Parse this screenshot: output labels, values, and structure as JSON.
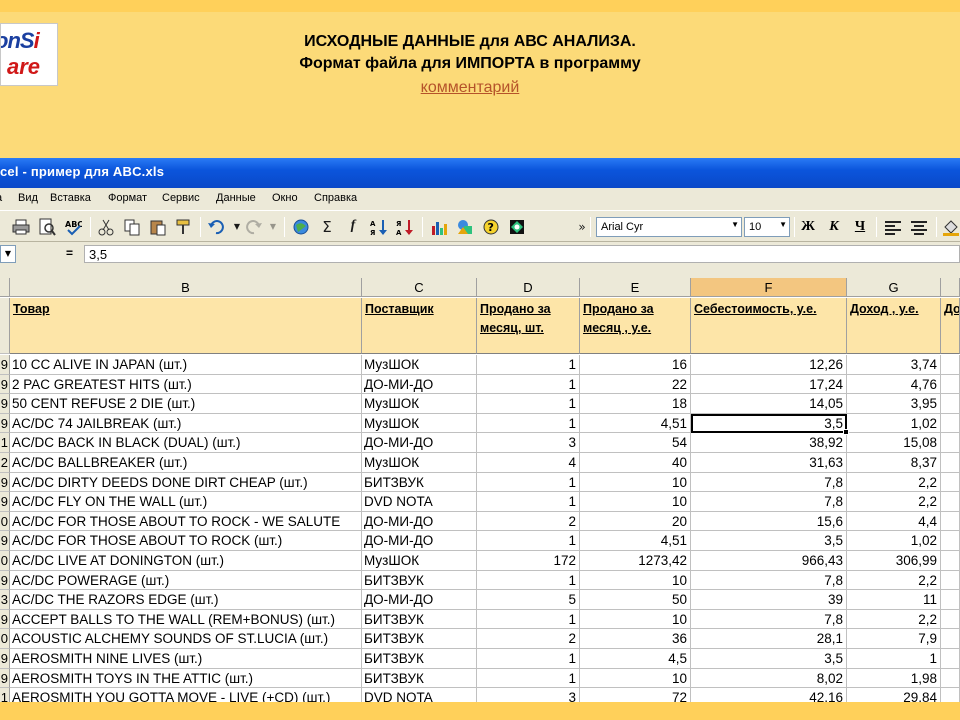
{
  "slide": {
    "logo_line1_a": "onS",
    "logo_line1_b": "i",
    "logo_line2": "are",
    "heading_line1": "ИСХОДНЫЕ ДАННЫЕ для АВС АНАЛИЗА.",
    "heading_line2": "Формат файла для ИМПОРТА в программу",
    "link_label": "комментарий"
  },
  "window": {
    "title": "cel - пример для ABC.xls"
  },
  "menu": [
    "а",
    "Вид",
    "Вставка",
    "Формат",
    "Сервис",
    "Данные",
    "Окно",
    "Справка"
  ],
  "toolbar": {
    "icons": [
      "print-icon",
      "print-preview-icon",
      "spelling-icon",
      "cut-icon",
      "copy-icon",
      "paste-icon",
      "format-painter-icon",
      "undo-icon",
      "redo-icon",
      "hyperlink-icon",
      "autosum-icon",
      "function-icon",
      "sort-ascending-icon",
      "sort-descending-icon",
      "chart-wizard-icon",
      "drawing-icon",
      "help-icon",
      "shapes-icon"
    ],
    "sigma": "Σ",
    "fx": "f",
    "more": "»",
    "font_name": "Arial Cyr",
    "font_size": "10",
    "bold": "Ж",
    "italic": "К",
    "underline": "Ч"
  },
  "formula_bar": {
    "equals": "=",
    "value": "3,5"
  },
  "sheet": {
    "column_letters": [
      "B",
      "C",
      "D",
      "E",
      "F",
      "G"
    ],
    "headers": {
      "product": "Товар",
      "supplier": "Поставщик",
      "sold_qty": "Продано за месяц, шт.",
      "sold_sum": "Продано за месяц , у.е.",
      "cost": "Себестоимость, у.е.",
      "income": "Доход , у.е.",
      "next": "До"
    },
    "rows": [
      {
        "a": "9",
        "product": "10 CC ALIVE IN JAPAN (шт.)",
        "supplier": "МузШОК",
        "qty": "1",
        "sum": "16",
        "cost": "12,26",
        "income": "3,74"
      },
      {
        "a": "9",
        "product": "2 PAC GREATEST HITS (шт.)",
        "supplier": "ДО-МИ-ДО",
        "qty": "1",
        "sum": "22",
        "cost": "17,24",
        "income": "4,76"
      },
      {
        "a": "9",
        "product": "50 CENT REFUSE 2 DIE (шт.)",
        "supplier": "МузШОК",
        "qty": "1",
        "sum": "18",
        "cost": "14,05",
        "income": "3,95"
      },
      {
        "a": "9",
        "product": "AC/DC 74 JAILBREAK (шт.)",
        "supplier": "МузШОК",
        "qty": "1",
        "sum": "4,51",
        "cost": "3,5",
        "income": "1,02"
      },
      {
        "a": "1",
        "product": "AC/DC BACK IN BLACK (DUAL) (шт.)",
        "supplier": "ДО-МИ-ДО",
        "qty": "3",
        "sum": "54",
        "cost": "38,92",
        "income": "15,08"
      },
      {
        "a": "2",
        "product": "AC/DC BALLBREAKER (шт.)",
        "supplier": "МузШОК",
        "qty": "4",
        "sum": "40",
        "cost": "31,63",
        "income": "8,37"
      },
      {
        "a": "9",
        "product": "AC/DC DIRTY DEEDS DONE DIRT CHEAP (шт.)",
        "supplier": "БИТЗВУК",
        "qty": "1",
        "sum": "10",
        "cost": "7,8",
        "income": "2,2"
      },
      {
        "a": "9",
        "product": "AC/DC FLY ON THE WALL (шт.)",
        "supplier": "DVD NOTA",
        "qty": "1",
        "sum": "10",
        "cost": "7,8",
        "income": "2,2"
      },
      {
        "a": "0",
        "product": "AC/DC FOR THOSE ABOUT TO ROCK - WE SALUTE",
        "supplier": "ДО-МИ-ДО",
        "qty": "2",
        "sum": "20",
        "cost": "15,6",
        "income": "4,4"
      },
      {
        "a": "9",
        "product": "AC/DC FOR THOSE ABOUT TO ROCK (шт.)",
        "supplier": "ДО-МИ-ДО",
        "qty": "1",
        "sum": "4,51",
        "cost": "3,5",
        "income": "1,02"
      },
      {
        "a": "0",
        "product": "AC/DC LIVE AT DONINGTON (шт.)",
        "supplier": "МузШОК",
        "qty": "172",
        "sum": "1273,42",
        "cost": "966,43",
        "income": "306,99"
      },
      {
        "a": "9",
        "product": "AC/DC POWERAGE (шт.)",
        "supplier": "БИТЗВУК",
        "qty": "1",
        "sum": "10",
        "cost": "7,8",
        "income": "2,2"
      },
      {
        "a": "3",
        "product": "AC/DC THE RAZORS EDGE (шт.)",
        "supplier": "ДО-МИ-ДО",
        "qty": "5",
        "sum": "50",
        "cost": "39",
        "income": "11"
      },
      {
        "a": "9",
        "product": "ACCEPT BALLS TO THE WALL (REM+BONUS) (шт.)",
        "supplier": "БИТЗВУК",
        "qty": "1",
        "sum": "10",
        "cost": "7,8",
        "income": "2,2"
      },
      {
        "a": "0",
        "product": "ACOUSTIC ALCHEMY SOUNDS OF ST.LUCIA (шт.)",
        "supplier": "БИТЗВУК",
        "qty": "2",
        "sum": "36",
        "cost": "28,1",
        "income": "7,9"
      },
      {
        "a": "9",
        "product": "AEROSMITH NINE LIVES (шт.)",
        "supplier": "БИТЗВУК",
        "qty": "1",
        "sum": "4,5",
        "cost": "3,5",
        "income": "1"
      },
      {
        "a": "9",
        "product": "AEROSMITH TOYS IN THE ATTIC (шт.)",
        "supplier": "БИТЗВУК",
        "qty": "1",
        "sum": "10",
        "cost": "8,02",
        "income": "1,98"
      },
      {
        "a": "1",
        "product": "AEROSMITH YOU GOTTA MOVE - LIVE (+CD) (шт.)",
        "supplier": "DVD NOTA",
        "qty": "3",
        "sum": "72",
        "cost": "42,16",
        "income": "29,84"
      }
    ]
  }
}
